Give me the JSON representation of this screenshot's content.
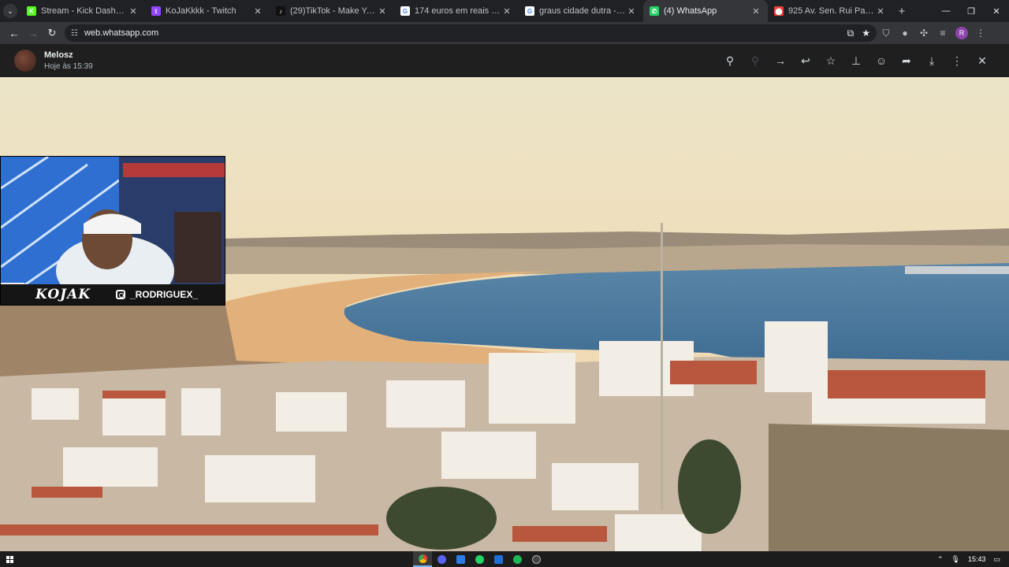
{
  "browser": {
    "tabs": [
      {
        "title": "Stream - Kick Dashboard",
        "favicon": "kick-icon",
        "color": "#53fc18",
        "glyph": "K",
        "active": false
      },
      {
        "title": "KoJaKkkk - Twitch",
        "favicon": "twitch-icon",
        "color": "#9146ff",
        "glyph": "t",
        "active": false
      },
      {
        "title": "(29)TikTok - Make Your Day",
        "favicon": "tiktok-icon",
        "color": "#111111",
        "glyph": "♪",
        "active": false
      },
      {
        "title": "174 euros em reais - Pesquisa G",
        "favicon": "google-icon",
        "color": "#ffffff",
        "glyph": "G",
        "active": false
      },
      {
        "title": "graus cidade dutra - Pesquisa G",
        "favicon": "google-icon",
        "color": "#ffffff",
        "glyph": "G",
        "active": false
      },
      {
        "title": "(4) WhatsApp",
        "favicon": "whatsapp-icon",
        "color": "#25d366",
        "glyph": "✆",
        "active": true
      },
      {
        "title": "925 Av. Sen. Rui Palmeira - Goo",
        "favicon": "maps-pin-icon",
        "color": "#ea4335",
        "glyph": "⬤",
        "active": false
      }
    ],
    "new_tab": "+",
    "url": "web.whatsapp.com"
  },
  "whatsapp": {
    "sender_name": "Melosz",
    "sent_time": "Hoje às 15:39"
  },
  "overlay": {
    "logo_text": "KOJAK",
    "instagram_handle": "_RODRIGUEX_"
  },
  "taskbar": {
    "clock": "15:43"
  }
}
